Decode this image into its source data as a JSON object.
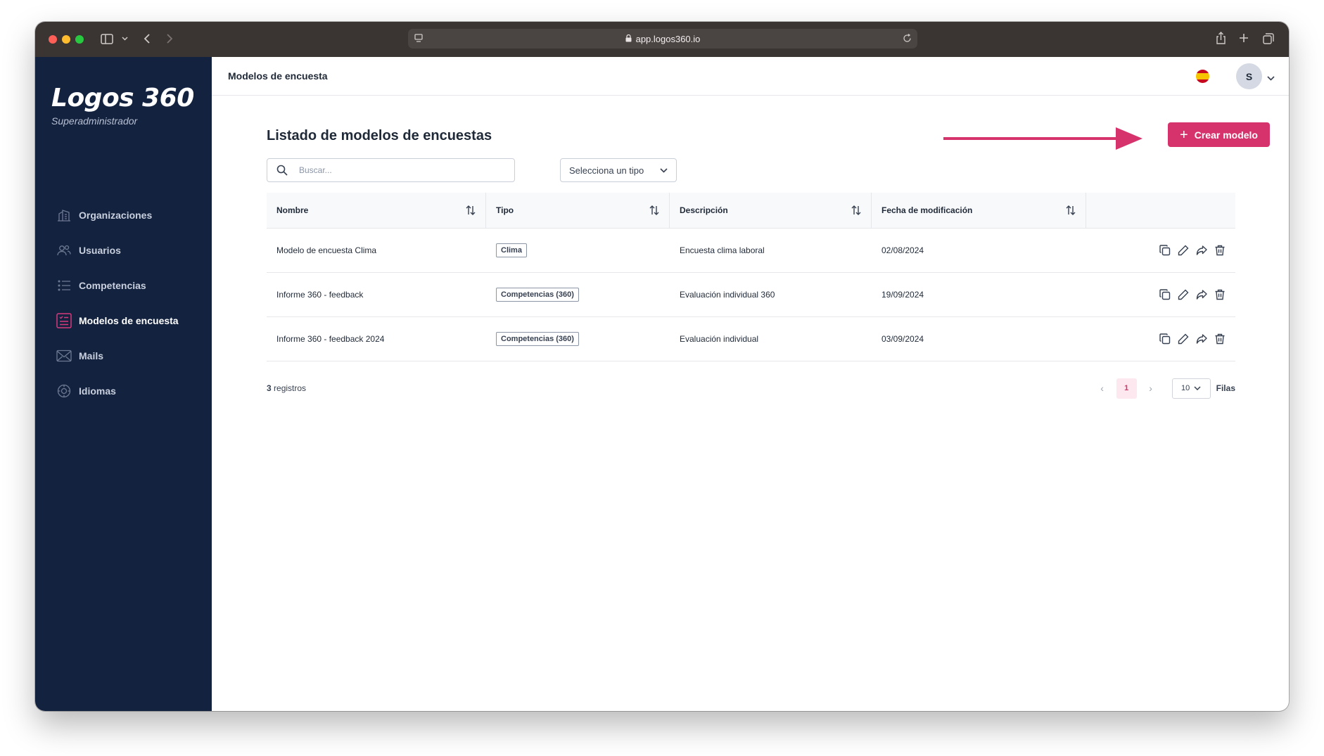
{
  "browser": {
    "url": "app.logos360.io"
  },
  "sidebar": {
    "logo": "Logos 360",
    "role": "Superadministrador",
    "items": [
      {
        "label": "Organizaciones",
        "icon": "building-icon"
      },
      {
        "label": "Usuarios",
        "icon": "users-icon"
      },
      {
        "label": "Competencias",
        "icon": "list-icon"
      },
      {
        "label": "Modelos de encuesta",
        "icon": "survey-icon",
        "active": true
      },
      {
        "label": "Mails",
        "icon": "mail-icon"
      },
      {
        "label": "Idiomas",
        "icon": "language-icon"
      }
    ]
  },
  "header": {
    "title": "Modelos de encuesta",
    "avatar_initial": "S",
    "language": "es"
  },
  "main": {
    "heading": "Listado de modelos de encuestas",
    "create_label": "Crear modelo",
    "search_placeholder": "Buscar...",
    "type_select": "Selecciona un tipo",
    "columns": [
      "Nombre",
      "Tipo",
      "Descripción",
      "Fecha de modificación"
    ],
    "rows": [
      {
        "nombre": "Modelo de encuesta Clima",
        "tipo": "Clima",
        "descripcion": "Encuesta clima laboral",
        "fecha": "02/08/2024"
      },
      {
        "nombre": "Informe 360 - feedback",
        "tipo": "Competencias (360)",
        "descripcion": "Evaluación individual 360",
        "fecha": "19/09/2024"
      },
      {
        "nombre": "Informe 360 - feedback 2024",
        "tipo": "Competencias (360)",
        "descripcion": "Evaluación individual",
        "fecha": "03/09/2024"
      }
    ],
    "records_count": "3",
    "records_label": "registros",
    "pagination": {
      "current_page": "1",
      "rows_per_page": "10",
      "rows_label": "Filas"
    }
  },
  "colors": {
    "accent": "#d6336c",
    "sidebar": "#13223f"
  }
}
